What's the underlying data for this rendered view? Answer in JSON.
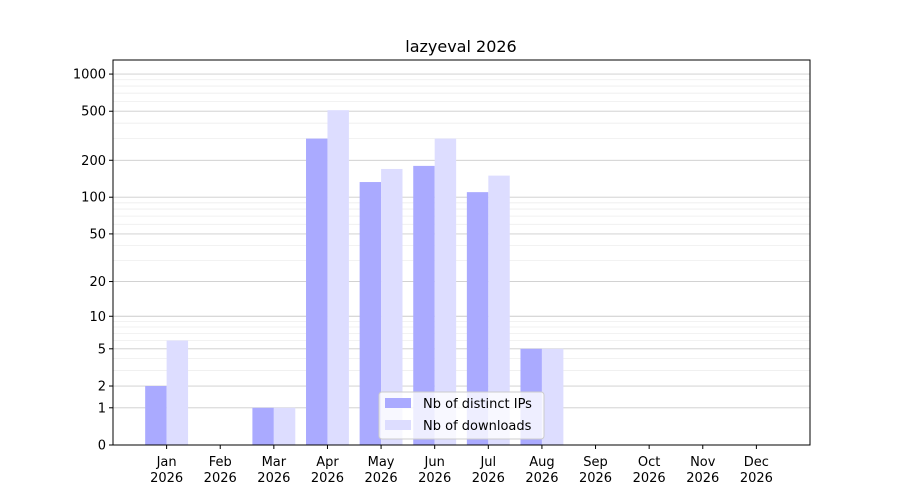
{
  "chart_data": {
    "type": "bar",
    "title": "lazyeval 2026",
    "xlabel": "",
    "ylabel": "",
    "yscale": "log(1+y)",
    "ylim": [
      0,
      1300
    ],
    "grid": "horizontal",
    "legend_position": "bottom-center",
    "yticks": [
      0,
      1,
      2,
      5,
      10,
      20,
      50,
      100,
      200,
      500,
      1000
    ],
    "ytick_labels": [
      "0",
      "1",
      "2",
      "5",
      "10",
      "20",
      "50",
      "100",
      "200",
      "500",
      "1000"
    ],
    "categories": [
      {
        "month": "Jan",
        "year": "2026"
      },
      {
        "month": "Feb",
        "year": "2026"
      },
      {
        "month": "Mar",
        "year": "2026"
      },
      {
        "month": "Apr",
        "year": "2026"
      },
      {
        "month": "May",
        "year": "2026"
      },
      {
        "month": "Jun",
        "year": "2026"
      },
      {
        "month": "Jul",
        "year": "2026"
      },
      {
        "month": "Aug",
        "year": "2026"
      },
      {
        "month": "Sep",
        "year": "2026"
      },
      {
        "month": "Oct",
        "year": "2026"
      },
      {
        "month": "Nov",
        "year": "2026"
      },
      {
        "month": "Dec",
        "year": "2026"
      }
    ],
    "series": [
      {
        "name": "Nb of distinct IPs",
        "color": "#aaaaff",
        "values": [
          2,
          0,
          1,
          300,
          133,
          180,
          110,
          5,
          0,
          0,
          0,
          0
        ]
      },
      {
        "name": "Nb of downloads",
        "color": "#ddddff",
        "values": [
          6,
          0,
          1,
          510,
          170,
          300,
          150,
          5,
          0,
          0,
          0,
          0
        ]
      }
    ]
  }
}
